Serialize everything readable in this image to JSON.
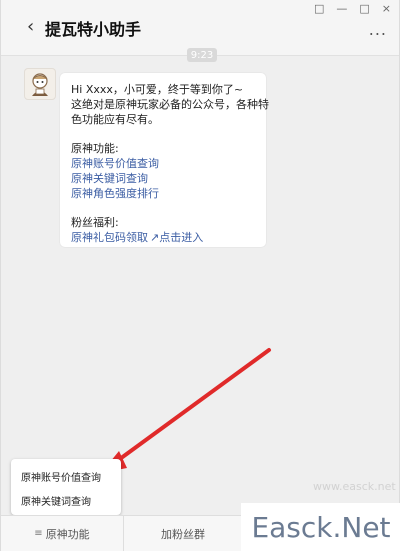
{
  "window": {
    "controls": [
      "□",
      "—",
      "□",
      "×"
    ]
  },
  "header": {
    "title": "提瓦特小助手",
    "back_icon": "chevron-left-icon",
    "more_label": "..."
  },
  "chat": {
    "time": "9:23",
    "avatar_icon": "bot-avatar-icon",
    "message": {
      "lines": [
        "Hi Xxxx，小可爱，终于等到你了~",
        "这绝对是原神玩家必备的公众号，各种特",
        "色功能应有尽有。"
      ],
      "section1_title": "原神功能:",
      "links": [
        "原神账号价值查询",
        "原神关键词查询",
        "原神角色强度排行"
      ],
      "section2_title": "粉丝福利:",
      "gift_link": "原神礼包码领取",
      "gift_link_tail": "点击进入"
    }
  },
  "popup_menu": {
    "items": [
      "原神账号价值查询",
      "原神关键词查询"
    ]
  },
  "bottom_bar": {
    "tabs": [
      "原神功能",
      "加粉丝群",
      ""
    ]
  },
  "watermark": {
    "text": "Easck.Net",
    "faint": "www.easck.net"
  },
  "colors": {
    "link": "#3b5da3",
    "arrow": "#e02a2a"
  }
}
